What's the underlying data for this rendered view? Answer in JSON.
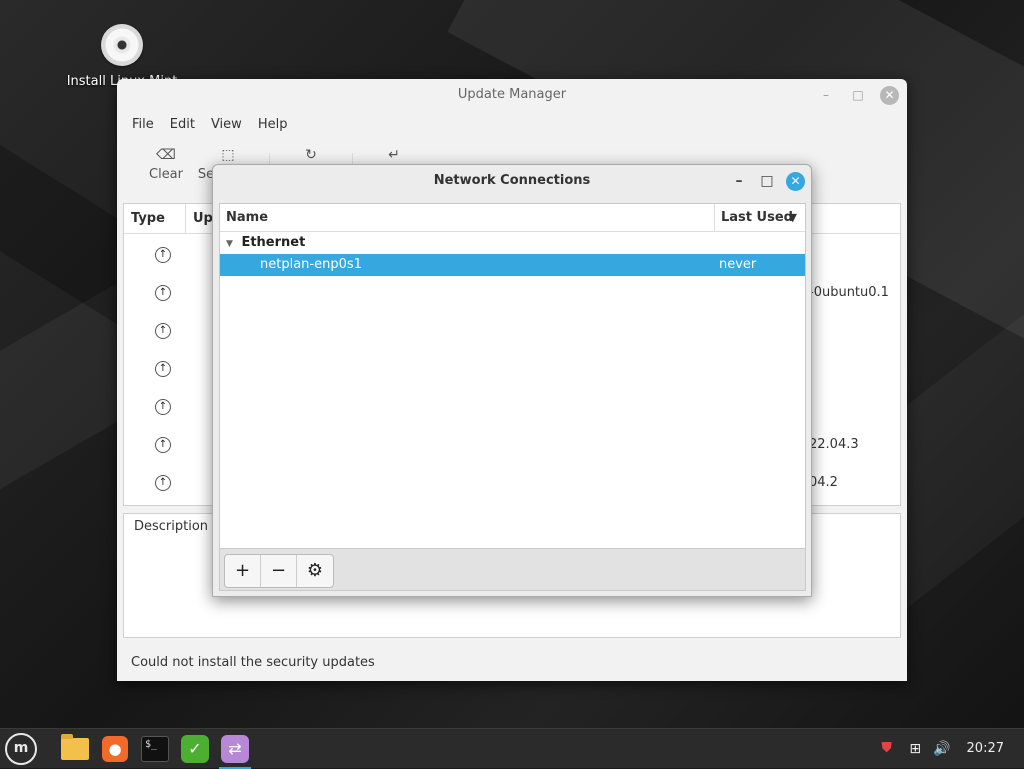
{
  "desktop": {
    "icon_label": "Install Linux Mint"
  },
  "update_manager": {
    "title": "Update Manager",
    "menu": [
      "File",
      "Edit",
      "View",
      "Help"
    ],
    "toolbar": {
      "clear_label": "Clear",
      "select_all_label": "Select All"
    },
    "columns": {
      "type": "Type",
      "upgrade": "Upgrade"
    },
    "rows": [
      {
        "version": ""
      },
      {
        "version": "-0ubuntu0.1"
      },
      {
        "version": ""
      },
      {
        "version": ""
      },
      {
        "version": ""
      },
      {
        "version": "22.04.3"
      },
      {
        "version": "04.2"
      }
    ],
    "description_tab": "Description",
    "status": "Could not install the security updates"
  },
  "network_connections": {
    "title": "Network Connections",
    "columns": {
      "name": "Name",
      "last_used": "Last Used"
    },
    "group": "Ethernet",
    "connection": {
      "name": "netplan-enp0s1",
      "last_used": "never"
    },
    "accent": "#35a8e0"
  },
  "panel": {
    "clock": "20:27"
  }
}
